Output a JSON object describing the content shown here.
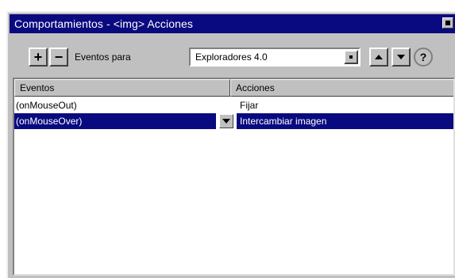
{
  "window": {
    "title": "Comportamientos - <img> Acciones"
  },
  "toolbar": {
    "add_label": "+",
    "remove_label": "−",
    "events_for_label": "Eventos para",
    "browser_select_value": "Exploradores 4.0",
    "help_label": "?"
  },
  "table": {
    "headers": [
      "Eventos",
      "Acciones"
    ],
    "rows": [
      {
        "event": "(onMouseOut)",
        "action": "Fijar"
      },
      {
        "event": "(onMouseOver)",
        "action": "Intercambiar imagen"
      }
    ],
    "selected_row": 1
  },
  "colors": {
    "titlebar": "#0a0a80",
    "selection": "#0a0a80",
    "chrome": "#c0c0c0"
  }
}
